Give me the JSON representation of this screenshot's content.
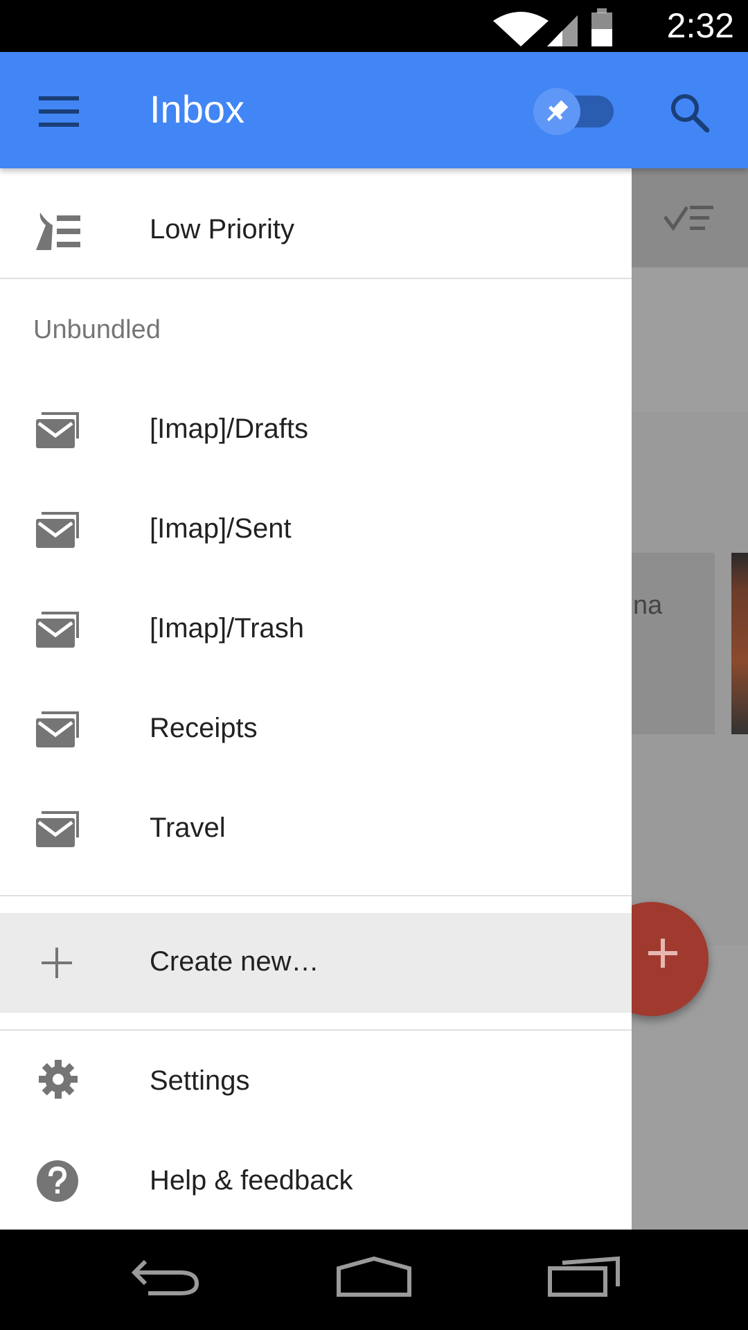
{
  "status_bar": {
    "time": "2:32"
  },
  "app_bar": {
    "title": "Inbox"
  },
  "drawer": {
    "low_priority_label": "Low Priority",
    "section_header": "Unbundled",
    "labels": [
      {
        "name": "[Imap]/Drafts"
      },
      {
        "name": "[Imap]/Sent"
      },
      {
        "name": "[Imap]/Trash"
      },
      {
        "name": "Receipts"
      },
      {
        "name": "Travel"
      }
    ],
    "create_new_label": "Create new…",
    "settings_label": "Settings",
    "help_label": "Help & feedback"
  },
  "background": {
    "card_text_fragment": "na"
  },
  "colors": {
    "app_bar": "#4285f4",
    "toggle_track": "#2a5cb0",
    "toggle_knob": "#5e97f6",
    "fab": "#a03a2e",
    "icon_gray": "#757575"
  }
}
